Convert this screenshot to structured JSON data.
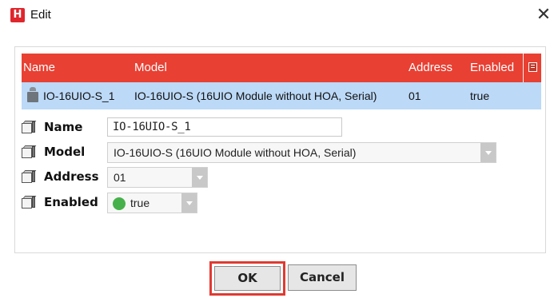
{
  "window": {
    "title": "Edit",
    "app_icon_letter": "H"
  },
  "table": {
    "header_color": "#e84033",
    "selected_row_color": "#bcd9f7",
    "columns": [
      "Name",
      "Model",
      "Address",
      "Enabled"
    ],
    "rows": [
      {
        "name": "IO-16UIO-S_1",
        "model": "IO-16UIO-S (16UIO Module without HOA, Serial)",
        "address": "01",
        "enabled": "true",
        "icon": "device-icon"
      }
    ]
  },
  "properties": {
    "name": {
      "label": "Name",
      "value": "IO-16UIO-S_1"
    },
    "model": {
      "label": "Model",
      "value": "IO-16UIO-S (16UIO Module without HOA, Serial)"
    },
    "address": {
      "label": "Address",
      "value": "01"
    },
    "enabled": {
      "label": "Enabled",
      "value": "true",
      "status_color": "#46b14a"
    }
  },
  "buttons": {
    "ok": "OK",
    "cancel": "Cancel"
  }
}
